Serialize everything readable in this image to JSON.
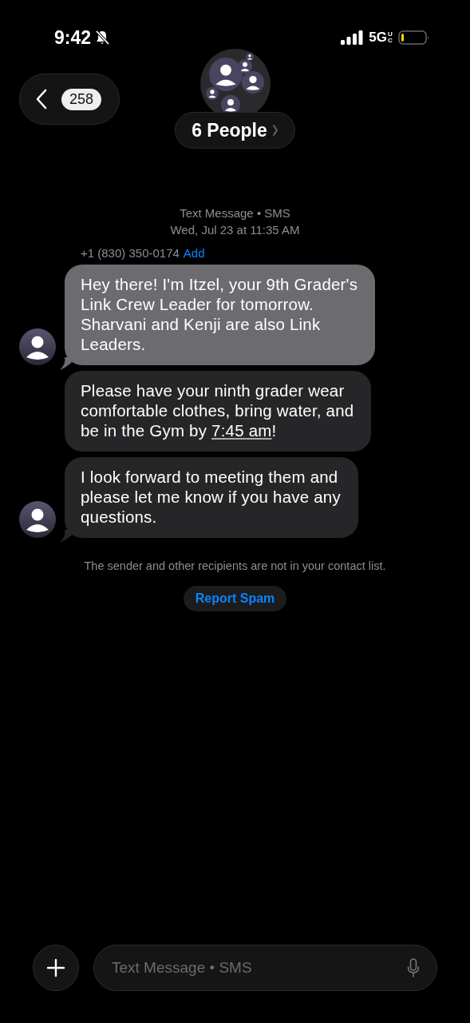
{
  "status_bar": {
    "time": "9:42",
    "silent": true,
    "network": "5G",
    "network_badge": "UC"
  },
  "nav": {
    "unread_count": "258",
    "title": "6 People"
  },
  "thread_header": {
    "service": "Text Message • SMS",
    "timestamp": "Wed, Jul 23 at 11:35 AM"
  },
  "sender": {
    "phone": "+1 (830) 350-0174",
    "add_link": "Add"
  },
  "messages": [
    {
      "selected": true,
      "show_avatar": true,
      "parts": [
        {
          "kind": "text",
          "text": "Hey there! I'm Itzel, your 9th Grader's\nLink Crew Leader for tomorrow.\nSharvani and Kenji are also Link\nLeaders."
        }
      ]
    },
    {
      "selected": false,
      "show_avatar": false,
      "parts": [
        {
          "kind": "text",
          "text": "Please have your ninth grader wear\ncomfortable clothes, bring water, and\nbe in the Gym by "
        },
        {
          "kind": "link",
          "text": "7:45 am"
        },
        {
          "kind": "text",
          "text": "!"
        }
      ]
    },
    {
      "selected": false,
      "show_avatar": true,
      "parts": [
        {
          "kind": "text",
          "text": "I look forward to meeting them and\nplease let me know if you have any\nquestions."
        }
      ]
    }
  ],
  "notice": "The sender and other recipients are not in your contact list.",
  "report_button": "Report Spam",
  "composer": {
    "placeholder": "Text Message • SMS"
  }
}
